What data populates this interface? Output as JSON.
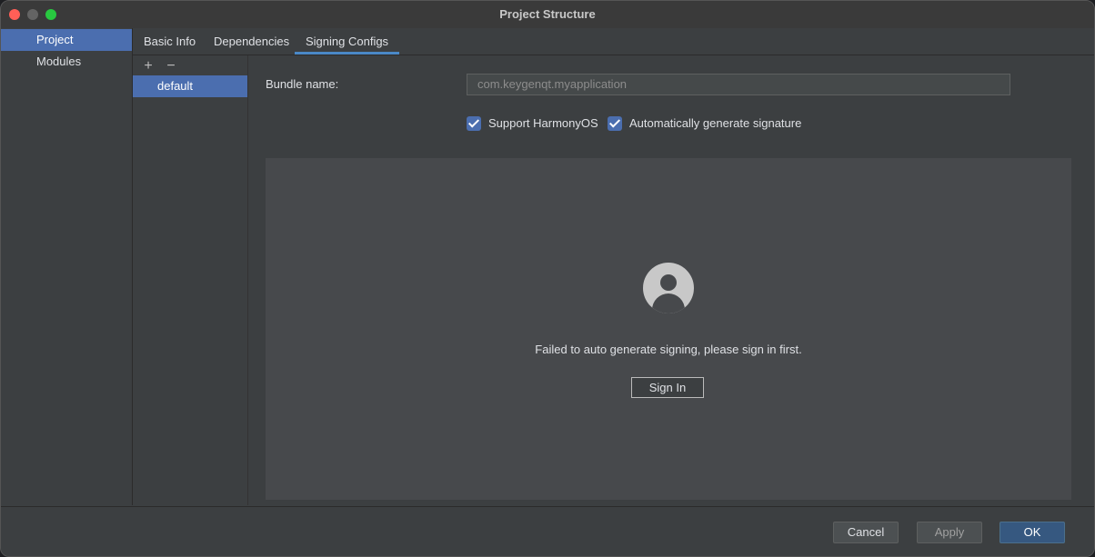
{
  "window": {
    "title": "Project Structure"
  },
  "sidebar": {
    "items": [
      {
        "label": "Project",
        "selected": true
      },
      {
        "label": "Modules",
        "selected": false
      }
    ]
  },
  "tabs": [
    {
      "label": "Basic Info"
    },
    {
      "label": "Dependencies"
    },
    {
      "label": "Signing Configs",
      "active": true
    }
  ],
  "configs": {
    "add_symbol": "+",
    "remove_symbol": "−",
    "items": [
      {
        "label": "default"
      }
    ]
  },
  "form": {
    "bundle_label": "Bundle name:",
    "bundle_value": "com.keygenqt.myapplication",
    "support_harmony": {
      "label": "Support HarmonyOS",
      "checked": true
    },
    "auto_sign": {
      "label": "Automatically generate signature",
      "checked": true
    }
  },
  "signin_panel": {
    "message": "Failed to auto generate signing, please sign in first.",
    "button": "Sign In"
  },
  "footer": {
    "cancel": "Cancel",
    "apply": "Apply",
    "ok": "OK"
  },
  "colors": {
    "accent": "#4b6eaf",
    "tab_underline": "#4a88c7",
    "ok_button": "#365880"
  }
}
